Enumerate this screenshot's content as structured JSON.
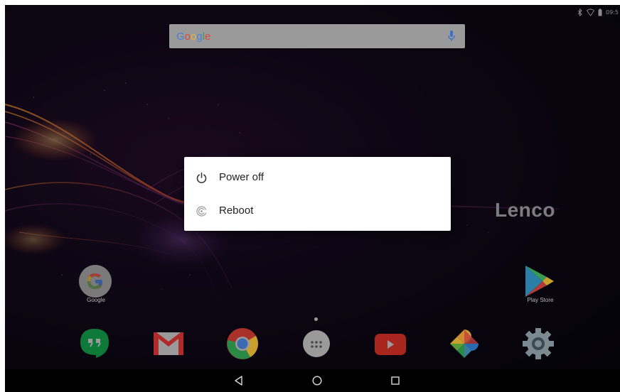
{
  "status_bar": {
    "time": "09:5"
  },
  "search_bar": {
    "logo_letters": [
      "G",
      "o",
      "o",
      "g",
      "l",
      "e"
    ],
    "logo_colors": [
      "#4a7fd8",
      "#d94a3a",
      "#e0b83a",
      "#4a7fd8",
      "#3aa050",
      "#d94a3a"
    ]
  },
  "wallpaper": {
    "brand": "Lenco"
  },
  "home_apps": [
    {
      "label": "Google"
    },
    {
      "label": "Play Store"
    }
  ],
  "dock": [
    {
      "name": "hangouts-icon"
    },
    {
      "name": "gmail-icon"
    },
    {
      "name": "chrome-icon"
    },
    {
      "name": "app-drawer-icon"
    },
    {
      "name": "youtube-icon"
    },
    {
      "name": "photos-icon"
    },
    {
      "name": "settings-icon"
    }
  ],
  "power_menu": {
    "items": [
      {
        "label": "Power off",
        "icon": "power-icon"
      },
      {
        "label": "Reboot",
        "icon": "reboot-icon"
      }
    ]
  },
  "nav_bar": {
    "buttons": [
      "back",
      "home",
      "recents"
    ]
  }
}
